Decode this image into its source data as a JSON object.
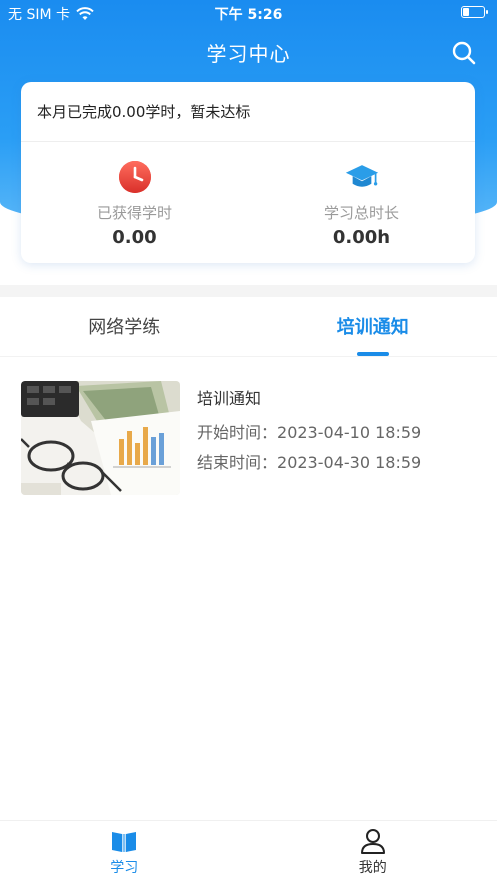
{
  "status_bar": {
    "carrier": "无 SIM 卡",
    "time": "下午 5:26"
  },
  "header": {
    "title": "学习中心",
    "search_icon": "search-icon"
  },
  "summary": {
    "status_text": "本月已完成0.00学时，暂未达标",
    "stats": [
      {
        "icon": "clock-icon",
        "label": "已获得学时",
        "value": "0.00"
      },
      {
        "icon": "graduation-cap-icon",
        "label": "学习总时长",
        "value": "0.00h"
      }
    ]
  },
  "tabs": [
    {
      "label": "网络学练",
      "active": false
    },
    {
      "label": "培训通知",
      "active": true
    }
  ],
  "notices": [
    {
      "title": "培训通知",
      "start_label": "开始时间：",
      "start_value": "2023-04-10 18:59",
      "end_label": "结束时间：",
      "end_value": "2023-04-30 18:59"
    }
  ],
  "tabbar": [
    {
      "icon": "book-icon",
      "label": "学习",
      "active": true
    },
    {
      "icon": "person-icon",
      "label": "我的",
      "active": false
    }
  ],
  "colors": {
    "brand_blue": "#1a8ce8",
    "header_gradient_top": "#1a8cf0",
    "clock_red": "#e8453c",
    "cap_blue": "#2a9de8"
  }
}
